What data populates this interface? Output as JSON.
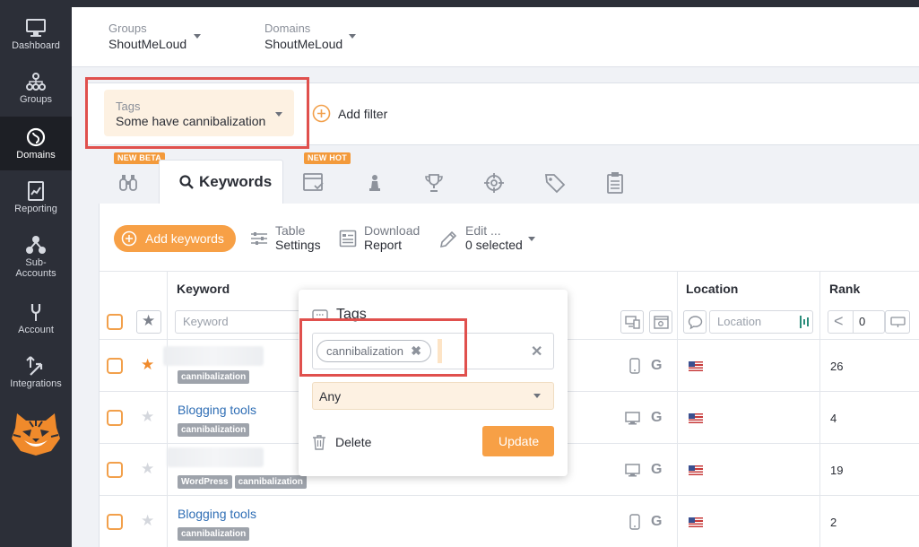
{
  "sidebar": {
    "items": [
      {
        "label": "Dashboard",
        "icon": "monitor-icon"
      },
      {
        "label": "Groups",
        "icon": "groups-icon"
      },
      {
        "label": "Domains",
        "icon": "domains-icon",
        "active": true
      },
      {
        "label": "Reporting",
        "icon": "reporting-icon"
      },
      {
        "label": "Sub-",
        "label2": "Accounts",
        "icon": "sub-accounts-icon"
      },
      {
        "label": "Account",
        "icon": "account-icon"
      },
      {
        "label": "Integrations",
        "icon": "integrations-icon"
      }
    ],
    "mascot": "tiger-logo"
  },
  "topbar": {
    "groups": {
      "label": "Groups",
      "value": "ShoutMeLoud"
    },
    "domains": {
      "label": "Domains",
      "value": "ShoutMeLoud"
    }
  },
  "filters": {
    "tags": {
      "label": "Tags",
      "value": "Some have cannibalization"
    },
    "add_filter": "Add filter"
  },
  "tabs": {
    "badge_new_beta": "NEW BETA",
    "badge_new_hot": "NEW HOT",
    "keywords": "Keywords"
  },
  "toolbar": {
    "add_keywords": "Add keywords",
    "table_settings": {
      "line1": "Table",
      "line2": "Settings"
    },
    "download_report": {
      "line1": "Download",
      "line2": "Report"
    },
    "edit": {
      "line1": "Edit ...",
      "line2": "0 selected"
    }
  },
  "table": {
    "headers": {
      "keyword": "Keyword",
      "location": "Location",
      "rank": "Rank"
    },
    "keyword_placeholder": "Keyword",
    "location_placeholder": "Location",
    "rank_filter": {
      "operator": "<",
      "value": "0"
    },
    "rows": [
      {
        "keyword": "",
        "tags": [
          "cannibalization"
        ],
        "starred": true,
        "device": "mobile",
        "rank": "26"
      },
      {
        "keyword": "Blogging tools",
        "tags": [
          "cannibalization"
        ],
        "starred": false,
        "device": "desktop",
        "rank": "4"
      },
      {
        "keyword": "",
        "tags": [
          "WordPress",
          "cannibalization"
        ],
        "starred": false,
        "device": "desktop",
        "rank": "19"
      },
      {
        "keyword": "Blogging tools",
        "tags": [
          "cannibalization"
        ],
        "starred": false,
        "device": "mobile",
        "rank": "2"
      }
    ]
  },
  "tags_popup": {
    "title": "Tags",
    "selected_tag": "cannibalization",
    "match_mode": "Any",
    "delete": "Delete",
    "update": "Update"
  },
  "colors": {
    "accent": "#f7a046",
    "highlight": "#e0504d",
    "sidebar": "#2c2f38",
    "link": "#2f6eb5"
  }
}
